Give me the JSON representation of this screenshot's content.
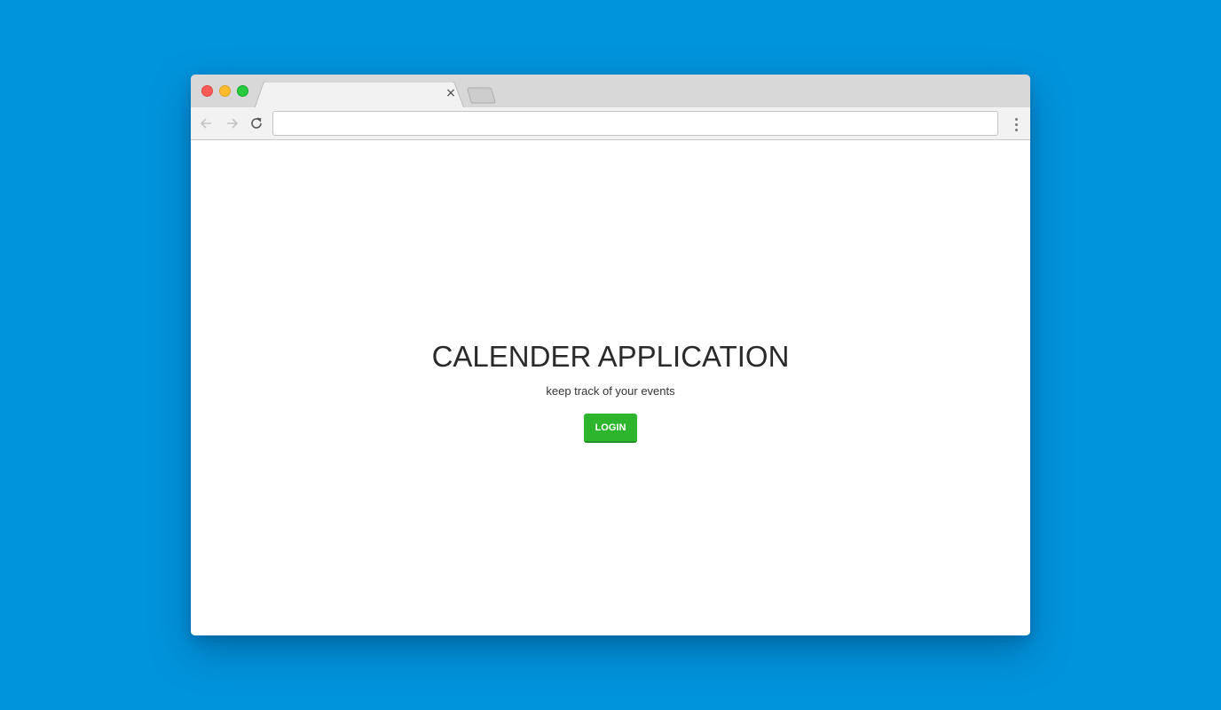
{
  "browser": {
    "tab_title": "",
    "tab_close_glyph": "×",
    "address_placeholder": "",
    "address_value": ""
  },
  "page": {
    "heading": "CALENDER APPLICATION",
    "subheading": "keep track of your events",
    "login_label": "LOGIN"
  },
  "colors": {
    "background": "#0094dc",
    "login_button": "#2db52d"
  },
  "icons": {
    "back": "arrow-left-icon",
    "forward": "arrow-right-icon",
    "reload": "reload-icon",
    "menu": "more-vertical-icon"
  }
}
